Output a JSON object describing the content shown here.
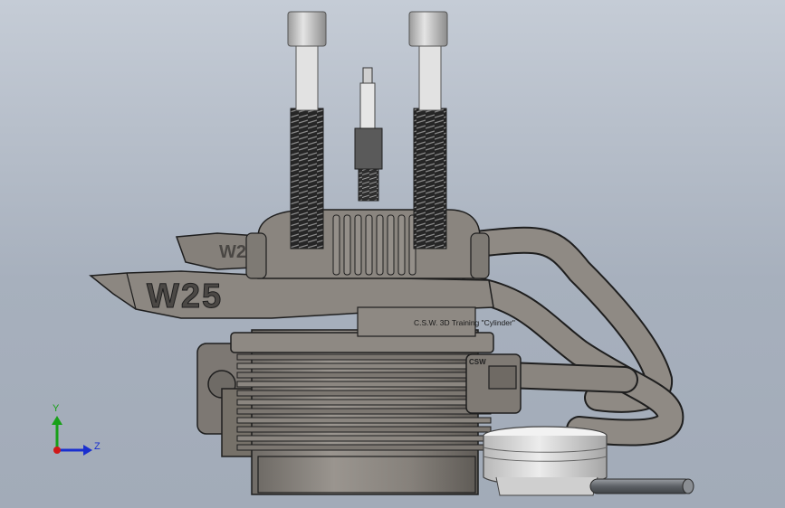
{
  "viewport": {
    "background_top": "#c5ccd6",
    "background_bottom": "#a2abb8"
  },
  "model": {
    "cylinder_label": "C.S.W. 3D Training \"Cylinder\"",
    "muffler_logo": "W25",
    "small_label": "CSW",
    "part_color": "#8a8680",
    "edge_color": "#1e1e1e"
  },
  "triad": {
    "y_label": "Y",
    "z_label": "Z",
    "y_color": "#18a018",
    "z_color": "#1a2fcf",
    "origin_color": "#d01818"
  }
}
